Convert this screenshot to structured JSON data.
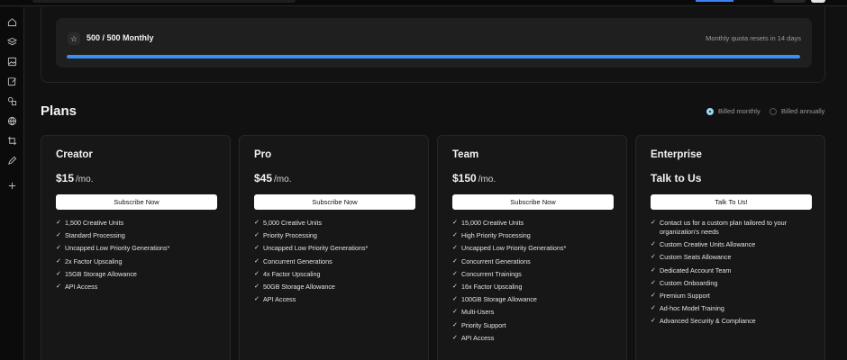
{
  "quota": {
    "title": "500 / 500 Monthly",
    "reset_text": "Monthly quota resets in 14 days",
    "progress": 1.0,
    "accent": "#3b8ff0"
  },
  "plans_section": {
    "title": "Plans",
    "billing_options": [
      "Billed monthly",
      "Billed annually"
    ],
    "selected_billing": "Billed monthly"
  },
  "plans": [
    {
      "name": "Creator",
      "price": "$15",
      "period": "/mo.",
      "cta": "Subscribe Now",
      "features": [
        "1,500 Creative Units",
        "Standard Processing",
        "Uncapped Low Priority Generations*",
        "2x Factor Upscaling",
        "15GB Storage Allowance",
        "API Access"
      ]
    },
    {
      "name": "Pro",
      "price": "$45",
      "period": "/mo.",
      "cta": "Subscribe Now",
      "features": [
        "5,000 Creative Units",
        "Priority Processing",
        "Uncapped Low Priority Generations*",
        "Concurrent Generations",
        "4x Factor Upscaling",
        "50GB Storage Allowance",
        "API Access"
      ]
    },
    {
      "name": "Team",
      "price": "$150",
      "period": "/mo.",
      "cta": "Subscribe Now",
      "features": [
        "15,000 Creative Units",
        "High Priority Processing",
        "Uncapped Low Priority Generations*",
        "Concurrent Generations",
        "Concurrent Trainings",
        "16x Factor Upscaling",
        "100GB Storage Allowance",
        "Multi-Users",
        "Priority Support",
        "API Access"
      ]
    },
    {
      "name": "Enterprise",
      "price": "Talk to Us",
      "period": "",
      "cta": "Talk To Us!",
      "features": [
        "Contact us for a custom plan tailored to your organization's needs",
        "Custom Creative Units Allowance",
        "Custom Seats Allowance",
        "Dedicated Account Team",
        "Custom Onboarding",
        "Premium Support",
        "Ad-hoc Model Training",
        "Advanced Security & Compliance"
      ]
    }
  ],
  "sidebar": {
    "icons": [
      "home-icon",
      "layers-icon",
      "image-icon",
      "edit-icon",
      "shapes-icon",
      "globe-icon",
      "crop-icon",
      "pen-icon",
      "plus-icon"
    ]
  },
  "colors": {
    "background": "#111111",
    "card": "#171717",
    "border": "#262626"
  }
}
